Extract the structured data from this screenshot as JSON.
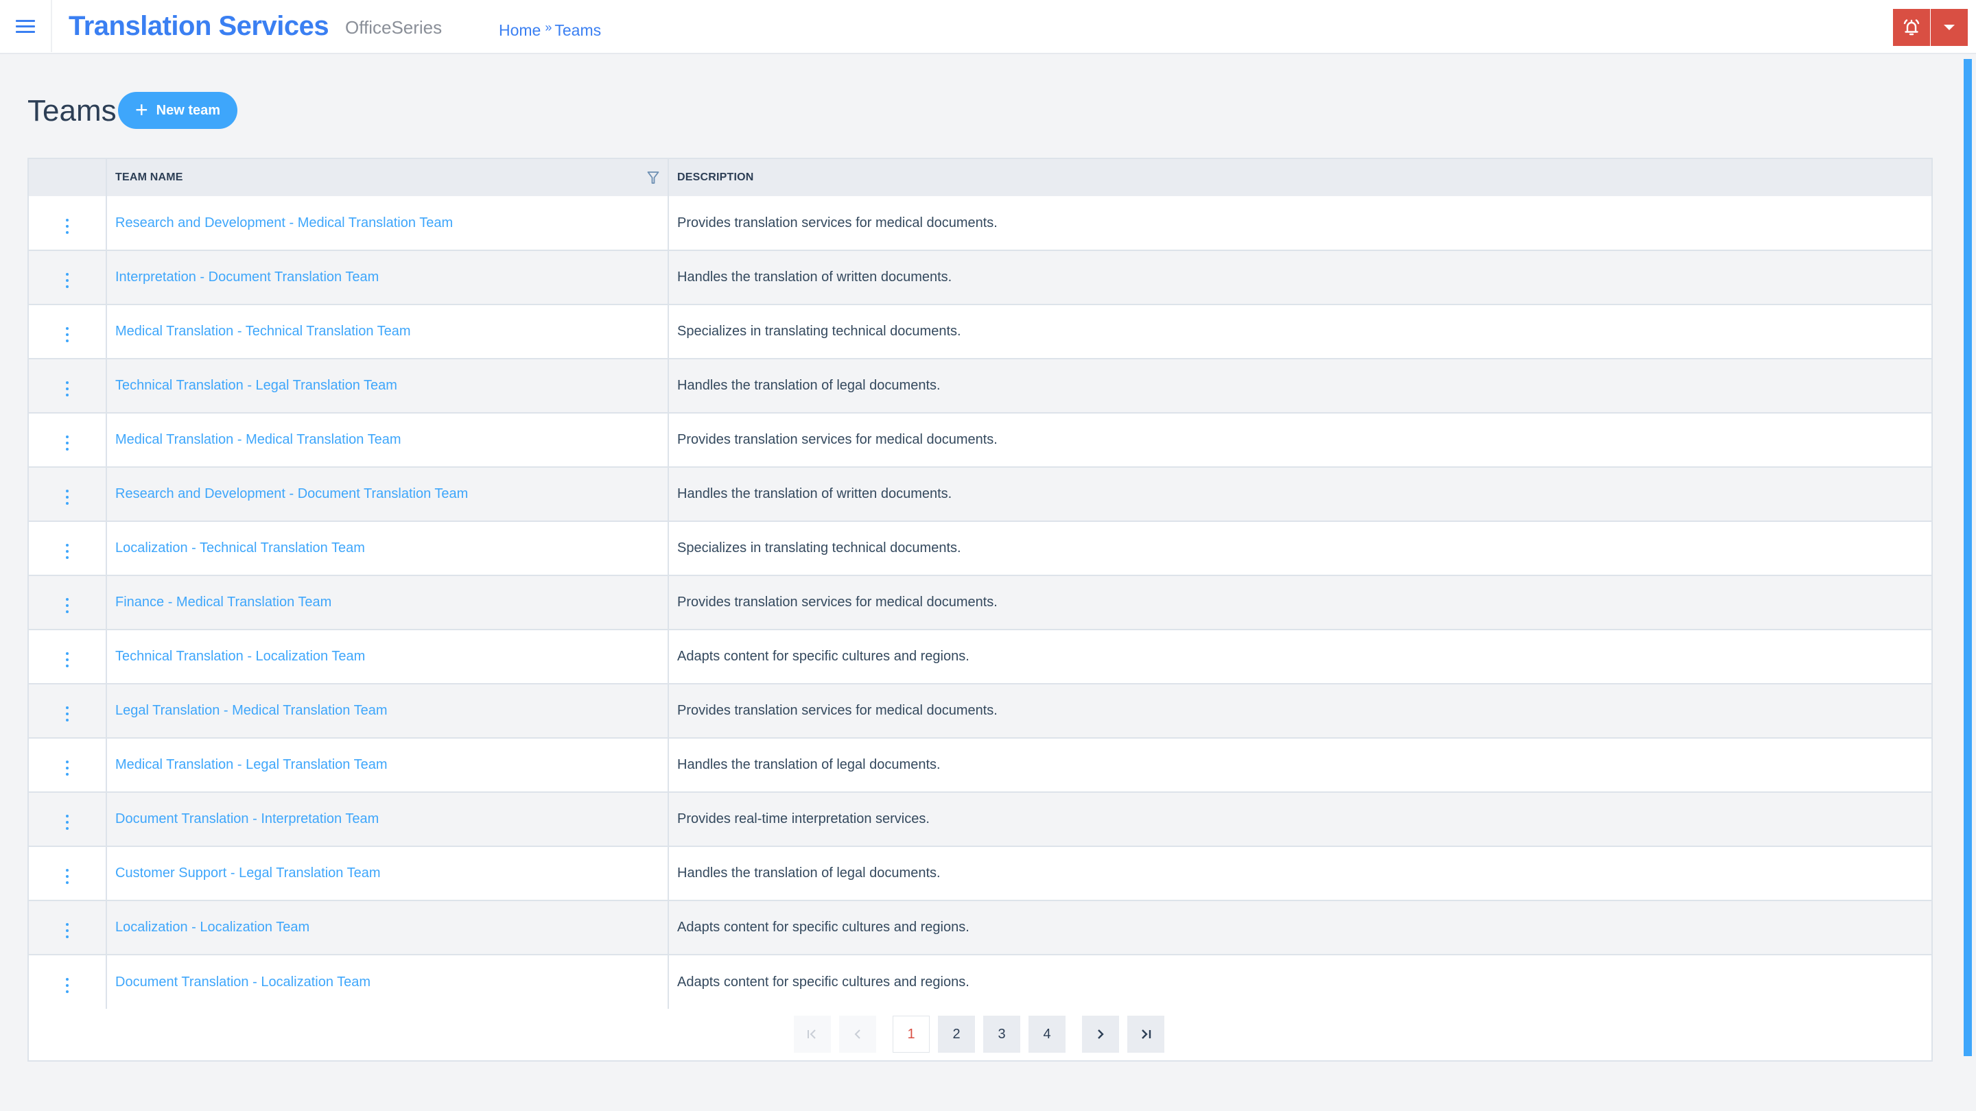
{
  "app": {
    "title": "Translation Services",
    "subtitle": "OfficeSeries",
    "menu_icon": "hamburger-menu-icon"
  },
  "breadcrumb": {
    "items": [
      {
        "label": "Home"
      },
      {
        "label": "Teams"
      }
    ],
    "separator": "»"
  },
  "header_actions": {
    "alert_icon": "bell-alert-icon",
    "dropdown_icon": "caret-down-icon",
    "color": "#d94f43"
  },
  "page": {
    "title": "Teams",
    "new_button_label": "New team",
    "new_button_icon": "plus-icon",
    "accent_color": "#3ea6fb"
  },
  "table": {
    "columns": [
      {
        "label": ""
      },
      {
        "label": "TEAM NAME",
        "filter_icon": "filter-icon"
      },
      {
        "label": "DESCRIPTION"
      }
    ],
    "rows": [
      {
        "name": "Research and Development - Medical Translation Team",
        "description": "Provides translation services for medical documents."
      },
      {
        "name": "Interpretation - Document Translation Team",
        "description": "Handles the translation of written documents."
      },
      {
        "name": "Medical Translation - Technical Translation Team",
        "description": "Specializes in translating technical documents."
      },
      {
        "name": "Technical Translation - Legal Translation Team",
        "description": "Handles the translation of legal documents."
      },
      {
        "name": "Medical Translation - Medical Translation Team",
        "description": "Provides translation services for medical documents."
      },
      {
        "name": "Research and Development - Document Translation Team",
        "description": "Handles the translation of written documents."
      },
      {
        "name": "Localization - Technical Translation Team",
        "description": "Specializes in translating technical documents."
      },
      {
        "name": "Finance - Medical Translation Team",
        "description": "Provides translation services for medical documents."
      },
      {
        "name": "Technical Translation - Localization Team",
        "description": "Adapts content for specific cultures and regions."
      },
      {
        "name": "Legal Translation - Medical Translation Team",
        "description": "Provides translation services for medical documents."
      },
      {
        "name": "Medical Translation - Legal Translation Team",
        "description": "Handles the translation of legal documents."
      },
      {
        "name": "Document Translation - Interpretation Team",
        "description": "Provides real-time interpretation services."
      },
      {
        "name": "Customer Support - Legal Translation Team",
        "description": "Handles the translation of legal documents."
      },
      {
        "name": "Localization - Localization Team",
        "description": "Adapts content for specific cultures and regions."
      },
      {
        "name": "Document Translation - Localization Team",
        "description": "Adapts content for specific cultures and regions."
      }
    ]
  },
  "pagination": {
    "first_icon": "first-page-icon",
    "prev_icon": "chevron-left-icon",
    "next_icon": "chevron-right-icon",
    "last_icon": "last-page-icon",
    "pages": [
      "1",
      "2",
      "3",
      "4"
    ],
    "current_page": "1",
    "first_label": "|<",
    "prev_label": "<",
    "next_label": ">",
    "last_label": ">|"
  }
}
